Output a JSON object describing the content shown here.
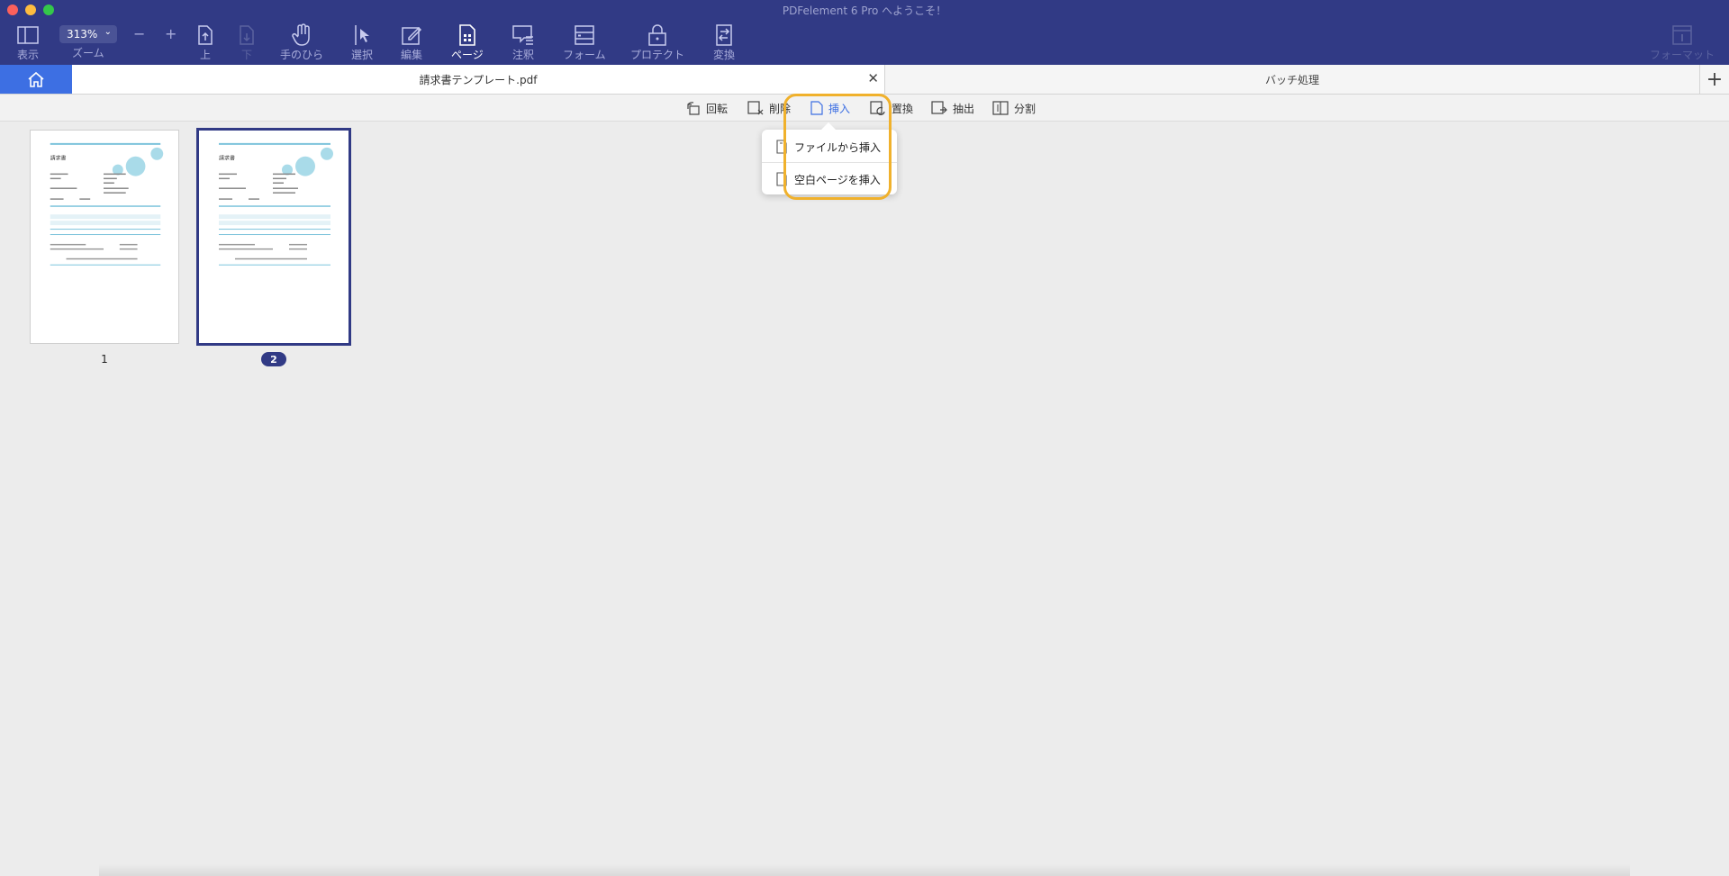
{
  "window": {
    "title": "PDFelement 6 Pro へようこそ！"
  },
  "toolbar": {
    "view_label": "表示",
    "zoom_value": "313%",
    "zoom_label": "ズーム",
    "zoom_out": "−",
    "zoom_in": "+",
    "up_label": "上",
    "down_label": "下",
    "hand_label": "手のひら",
    "select_label": "選択",
    "edit_label": "編集",
    "page_label": "ページ",
    "comment_label": "注釈",
    "form_label": "フォーム",
    "protect_label": "プロテクト",
    "convert_label": "変換",
    "format_label": "フォーマット"
  },
  "tabs": {
    "document": "請求書テンプレート.pdf",
    "batch": "バッチ処理",
    "new_tab": "+"
  },
  "page_toolbar": {
    "rotate": "回転",
    "delete": "削除",
    "insert": "挿入",
    "replace": "置換",
    "extract": "抽出",
    "split": "分割"
  },
  "insert_menu": {
    "from_file": "ファイルから挿入",
    "blank_page": "空白ページを挿入"
  },
  "pages": [
    {
      "number": "1",
      "selected": false
    },
    {
      "number": "2",
      "selected": true
    }
  ],
  "thumbnail_text": {
    "heading": "請求書"
  },
  "colors": {
    "toolbar_bg": "#313a85",
    "accent_blue": "#3d6fe3",
    "highlight_orange": "#f0b12c"
  }
}
